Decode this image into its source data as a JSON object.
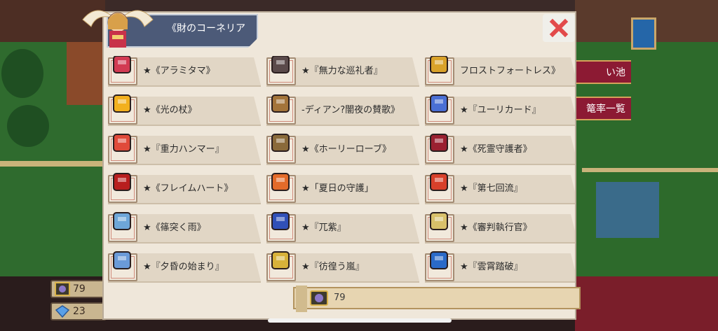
{
  "title": "《財のコーネリア",
  "colors": {
    "dialog_bg": "#efe7da",
    "banner": "#4c5a78",
    "close": "#e24a4a",
    "side_pill": "#8c1a33"
  },
  "close_icon": "close-x-icon",
  "side_buttons": {
    "pond": "い池",
    "rate": "篭率一覧"
  },
  "resources": {
    "gem_count": "79",
    "diamond_count": "23"
  },
  "bottom_bar": {
    "count": "79"
  },
  "items": [
    {
      "label": "★《アラミタマ》",
      "icon": "spear-blade-icon",
      "color": "#d23a52"
    },
    {
      "label": "★『無力な巡礼者』",
      "icon": "dark-helm-icon",
      "color": "#5a4a4a"
    },
    {
      "label": "フロストフォートレス》",
      "icon": "golden-armor-icon",
      "color": "#d9a22a"
    },
    {
      "label": "★《光の杖》",
      "icon": "sun-staff-icon",
      "color": "#f2b01e"
    },
    {
      "label": "-ディアン?闇夜の賛歌》",
      "icon": "bronze-helm-icon",
      "color": "#a3743a"
    },
    {
      "label": "★『ユーリカード』",
      "icon": "blue-gem-amulet-icon",
      "color": "#4a6fd4"
    },
    {
      "label": "★『重力ハンマー』",
      "icon": "red-hammer-icon",
      "color": "#e04a3a"
    },
    {
      "label": "★《ホーリーローブ》",
      "icon": "holy-robe-icon",
      "color": "#8a6a3a"
    },
    {
      "label": "★《死霊守護者》",
      "icon": "red-gauntlet-icon",
      "color": "#9a2030"
    },
    {
      "label": "★《フレイムハート》",
      "icon": "flame-armor-icon",
      "color": "#b81e1e"
    },
    {
      "label": "★「夏日の守護」",
      "icon": "feather-blade-icon",
      "color": "#e36b2a"
    },
    {
      "label": "★『第七回流』",
      "icon": "red-necklace-icon",
      "color": "#d8402a"
    },
    {
      "label": "★《篠突く雨》",
      "icon": "ice-spear-icon",
      "color": "#6ea6d8"
    },
    {
      "label": "★『兀紫』",
      "icon": "blue-gauntlet-icon",
      "color": "#3050b8"
    },
    {
      "label": "★《審判執行官》",
      "icon": "white-robe-icon",
      "color": "#d8c06a"
    },
    {
      "label": "★『夕昏の始まり』",
      "icon": "blue-ring-icon",
      "color": "#6a9ad8"
    },
    {
      "label": "★『彷徨う嵐』",
      "icon": "wind-feather-icon",
      "color": "#d8b23a"
    },
    {
      "label": "★『雲霄踏破』",
      "icon": "sky-boots-icon",
      "color": "#2a6ac8"
    }
  ]
}
